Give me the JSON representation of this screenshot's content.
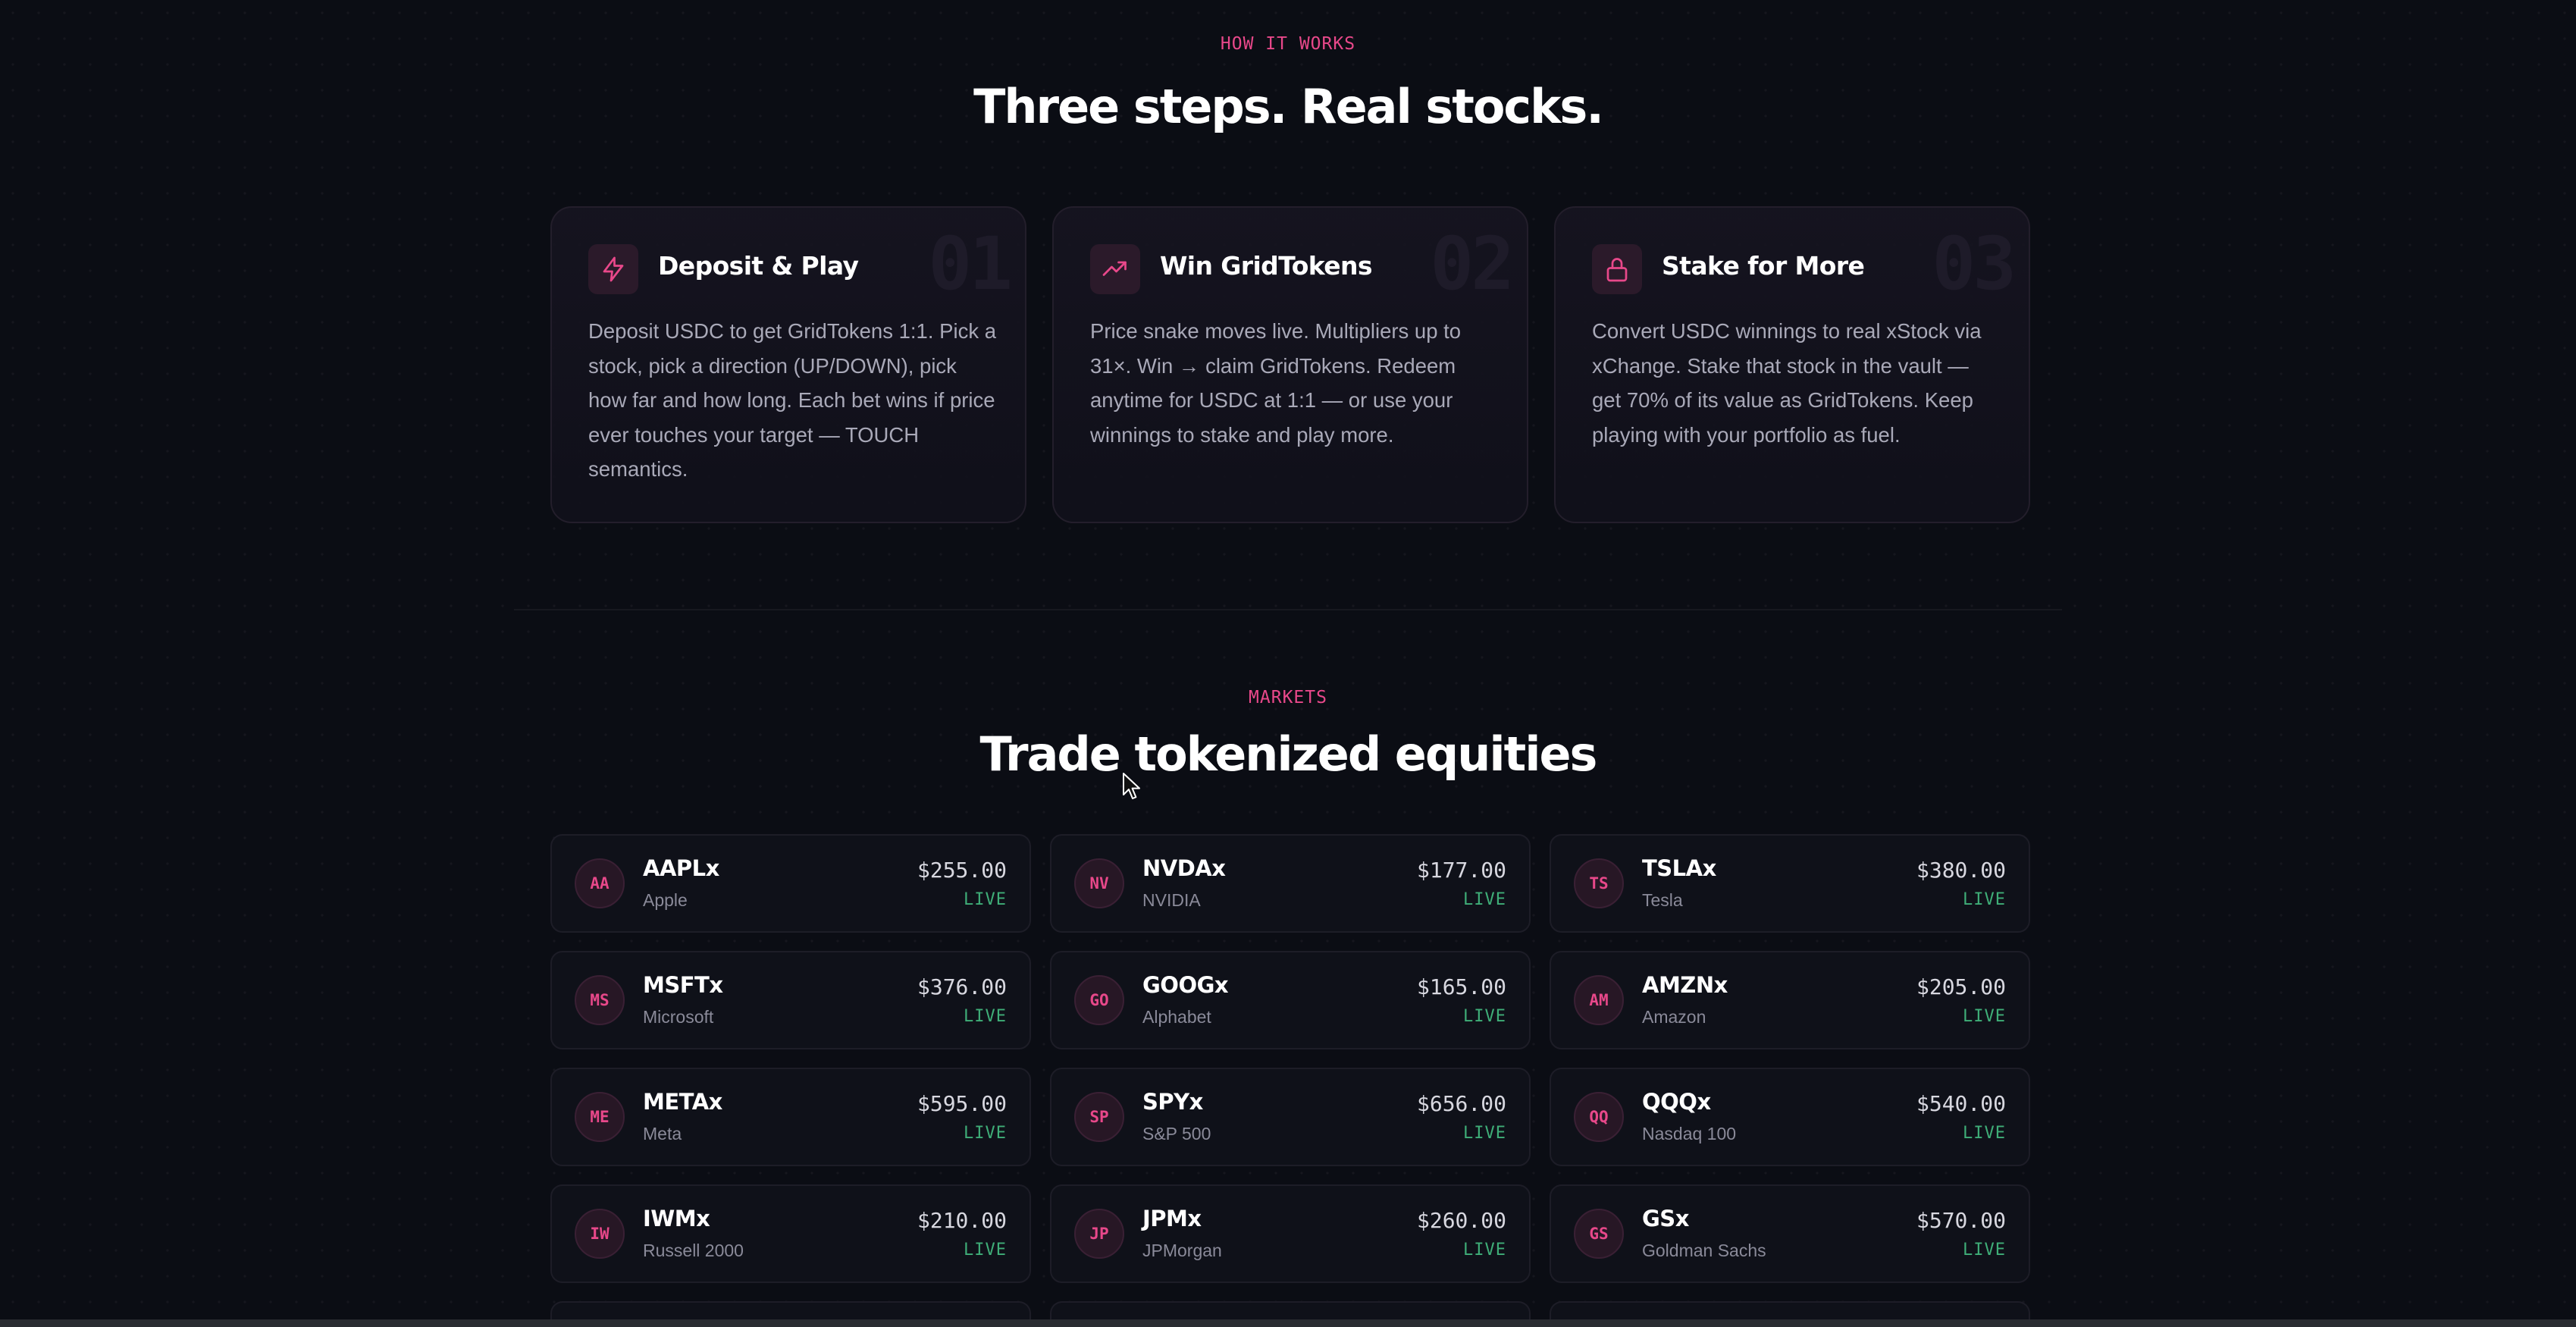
{
  "how_it_works": {
    "eyebrow": "HOW IT WORKS",
    "title": "Three steps. Real stocks.",
    "steps": [
      {
        "number": "01",
        "icon": "lightning-icon",
        "title": "Deposit & Play",
        "description": "Deposit USDC to get GridTokens 1:1. Pick a stock, pick a direction (UP/DOWN), pick how far and how long. Each bet wins if price ever touches your target — TOUCH semantics."
      },
      {
        "number": "02",
        "icon": "trending-up-icon",
        "title": "Win GridTokens",
        "description": "Price snake moves live. Multipliers up to 31×. Win → claim GridTokens. Redeem anytime for USDC at 1:1 — or use your winnings to stake and play more."
      },
      {
        "number": "03",
        "icon": "lock-icon",
        "title": "Stake for More",
        "description": "Convert USDC winnings to real xStock via xChange. Stake that stock in the vault — get 70% of its value as GridTokens. Keep playing with your portfolio as fuel."
      }
    ]
  },
  "markets": {
    "eyebrow": "MARKETS",
    "title": "Trade tokenized equities",
    "items": [
      {
        "initials": "AA",
        "symbol": "AAPLx",
        "name": "Apple",
        "price": "$255.00",
        "status": "LIVE"
      },
      {
        "initials": "NV",
        "symbol": "NVDAx",
        "name": "NVIDIA",
        "price": "$177.00",
        "status": "LIVE"
      },
      {
        "initials": "TS",
        "symbol": "TSLAx",
        "name": "Tesla",
        "price": "$380.00",
        "status": "LIVE"
      },
      {
        "initials": "MS",
        "symbol": "MSFTx",
        "name": "Microsoft",
        "price": "$376.00",
        "status": "LIVE"
      },
      {
        "initials": "GO",
        "symbol": "GOOGx",
        "name": "Alphabet",
        "price": "$165.00",
        "status": "LIVE"
      },
      {
        "initials": "AM",
        "symbol": "AMZNx",
        "name": "Amazon",
        "price": "$205.00",
        "status": "LIVE"
      },
      {
        "initials": "ME",
        "symbol": "METAx",
        "name": "Meta",
        "price": "$595.00",
        "status": "LIVE"
      },
      {
        "initials": "SP",
        "symbol": "SPYx",
        "name": "S&P 500",
        "price": "$656.00",
        "status": "LIVE"
      },
      {
        "initials": "QQ",
        "symbol": "QQQx",
        "name": "Nasdaq 100",
        "price": "$540.00",
        "status": "LIVE"
      },
      {
        "initials": "IW",
        "symbol": "IWMx",
        "name": "Russell 2000",
        "price": "$210.00",
        "status": "LIVE"
      },
      {
        "initials": "JP",
        "symbol": "JPMx",
        "name": "JPMorgan",
        "price": "$260.00",
        "status": "LIVE"
      },
      {
        "initials": "GS",
        "symbol": "GSx",
        "name": "Goldman Sachs",
        "price": "$570.00",
        "status": "LIVE"
      }
    ]
  },
  "colors": {
    "accent": "#e8488a",
    "live": "#3fae78",
    "background": "#0b0d14"
  }
}
